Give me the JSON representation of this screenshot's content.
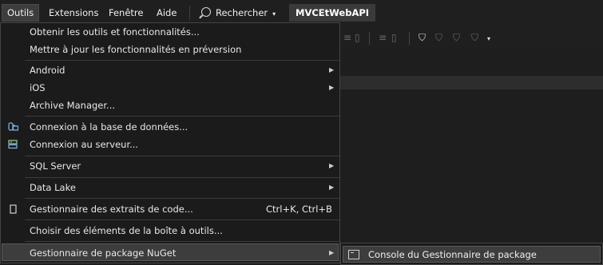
{
  "menubar": {
    "items": [
      "Outils",
      "Extensions",
      "Fenêtre",
      "Aide"
    ],
    "search_label": "Rechercher",
    "project_name": "MVCEtWebAPI"
  },
  "menu": {
    "items": [
      {
        "label": "Obtenir les outils et fonctionnalités..."
      },
      {
        "label": "Mettre à jour les fonctionnalités en préversion"
      },
      {
        "label": "Android"
      },
      {
        "label": "iOS"
      },
      {
        "label": "Archive Manager..."
      },
      {
        "label": "Connexion à la base de données..."
      },
      {
        "label": "Connexion au serveur..."
      },
      {
        "label": "SQL Server"
      },
      {
        "label": "Data Lake"
      },
      {
        "label": "Gestionnaire des extraits de code...",
        "shortcut": "Ctrl+K, Ctrl+B"
      },
      {
        "label": "Choisir des éléments de la boîte à outils..."
      },
      {
        "label": "Gestionnaire de package NuGet"
      }
    ]
  },
  "submenu": {
    "items": [
      {
        "label": "Console du Gestionnaire de package"
      }
    ]
  },
  "icons": {
    "database": "database-connect-icon",
    "server": "server-connect-icon",
    "snippets": "code-snippet-icon",
    "console": "console-window-icon"
  }
}
